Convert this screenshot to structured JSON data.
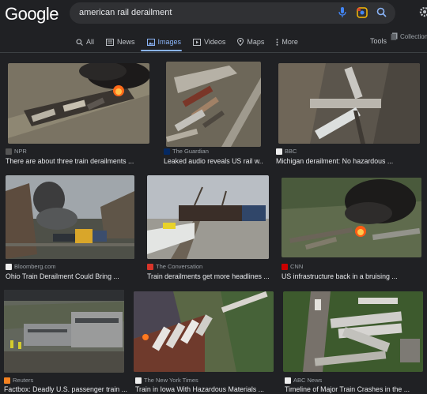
{
  "header": {
    "logo": "Google",
    "query": "american rail derailment"
  },
  "tabs": [
    {
      "label": "All",
      "icon": "search-icon"
    },
    {
      "label": "News",
      "icon": "news-icon"
    },
    {
      "label": "Images",
      "icon": "image-icon",
      "active": true
    },
    {
      "label": "Videos",
      "icon": "video-icon"
    },
    {
      "label": "Maps",
      "icon": "map-pin-icon"
    },
    {
      "label": "More",
      "icon": "kebab-icon"
    }
  ],
  "tools_label": "Tools",
  "collections_label": "Collection",
  "results": [
    {
      "source": "NPR",
      "title": "There are about three train derailments ...",
      "favicon": "#555555"
    },
    {
      "source": "The Guardian",
      "title": "Leaked audio reveals US rail w...",
      "favicon": "#052962"
    },
    {
      "source": "BBC",
      "title": "Michigan derailment: No hazardous ...",
      "favicon": "#eeeeee"
    },
    {
      "source": "Bloomberg.com",
      "title": "Ohio Train Derailment Could Bring ...",
      "favicon": "#eeeeee"
    },
    {
      "source": "The Conversation",
      "title": "Train derailments get more headlines ...",
      "favicon": "#d8352a"
    },
    {
      "source": "CNN",
      "title": "US infrastructure back in a bruising ...",
      "favicon": "#cc0000"
    },
    {
      "source": "Reuters",
      "title": "Factbox: Deadly U.S. passenger train ...",
      "favicon": "#f58220"
    },
    {
      "source": "The New York Times",
      "title": "Train in Iowa With Hazardous Materials ...",
      "favicon": "#eeeeee"
    },
    {
      "source": "ABC News",
      "title": "Timeline of Major Train Crashes in the ...",
      "favicon": "#eeeeee"
    }
  ]
}
